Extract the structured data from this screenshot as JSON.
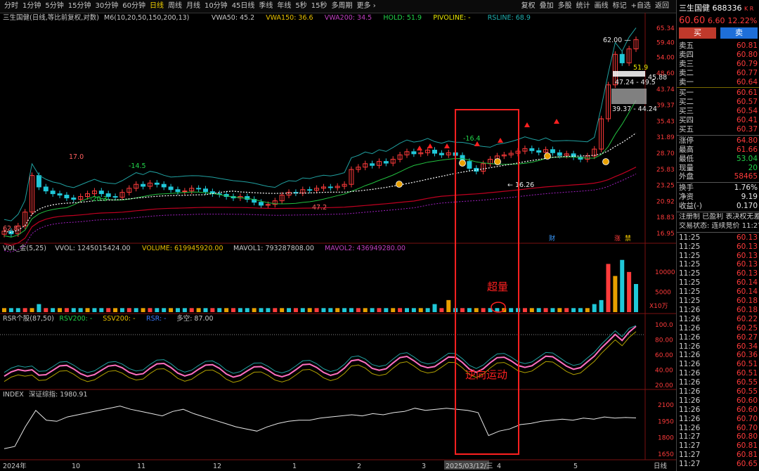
{
  "toolbar": {
    "periods": [
      "分时",
      "1分钟",
      "5分钟",
      "15分钟",
      "30分钟",
      "60分钟",
      "日线",
      "周线",
      "月线",
      "10分钟",
      "45日线",
      "季线",
      "年线",
      "5秒",
      "15秒",
      "多周期",
      "更多 ›"
    ],
    "active_period": "日线",
    "right_items": [
      "复权",
      "叠加",
      "多股",
      "统计",
      "画线",
      "标记",
      "+自选",
      "返回"
    ]
  },
  "main_chart": {
    "title": "三生国健(日线,等比前复权,对数)",
    "indicators": [
      {
        "text": "M6(10,20,50,150,200,13)",
        "color": "#c8c8c8"
      },
      {
        "text": "VWA50: 45.2",
        "color": "#c8c8c8"
      },
      {
        "text": "VWA150: 36.6",
        "color": "#e8c000"
      },
      {
        "text": "VWA200: 34.5",
        "color": "#c040c0"
      },
      {
        "text": "HOLD: 51.9",
        "color": "#22d34a"
      },
      {
        "text": "",
        "color": "#ff3b3b",
        "extra": "34.5"
      },
      {
        "text": "PIVOLINE: -",
        "color": "#e8e800"
      },
      {
        "text": "RSLINE: 68.9",
        "color": "#20b0b0"
      }
    ],
    "price_axis": [
      "65.34",
      "59.40",
      "54.00",
      "48.60",
      "43.74",
      "39.37",
      "35.43",
      "31.89",
      "28.70",
      "25.83",
      "23.25",
      "20.92",
      "18.83",
      "16.95"
    ],
    "annotations": [
      {
        "text": "62.8",
        "color": "#ff6060"
      },
      {
        "text": "17.0",
        "color": "#ff6060"
      },
      {
        "text": "-14.5",
        "color": "#22d34a"
      },
      {
        "text": "-20.3",
        "color": "#22d34a"
      },
      {
        "text": "47.2",
        "color": "#ff6060"
      },
      {
        "text": "-16.4",
        "color": "#22d34a"
      },
      {
        "text": "← 16.26",
        "color": "#e8e8e8"
      },
      {
        "text": "62.00 —",
        "color": "#e8e8e8"
      },
      {
        "text": "51.9",
        "color": "#e8e800"
      },
      {
        "text": "45.88",
        "color": "#e8e8e8"
      },
      {
        "text": "47.24 - 49.5",
        "color": "#e8e8e8"
      },
      {
        "text": "39.37 - 44.24",
        "color": "#e8e8e8"
      }
    ],
    "markers": [
      "财",
      "涨",
      "禁"
    ],
    "red_box_labels": [
      "超量",
      "逆向运动"
    ]
  },
  "volume_panel": {
    "header": [
      {
        "text": "VOL_金(5,25)",
        "color": "#c8c8c8"
      },
      {
        "text": "VVOL: 1245015424.00",
        "color": "#c8c8c8"
      },
      {
        "text": "VOLUME: 619945920.00",
        "color": "#e8c000"
      },
      {
        "text": "MAVOL1: 793287808.00",
        "color": "#c8c8c8"
      },
      {
        "text": "MAVOL2: 436949280.00",
        "color": "#c040c0"
      }
    ],
    "axis": [
      "10000",
      "5000"
    ],
    "unit": "X10万"
  },
  "rsr_panel": {
    "header": [
      {
        "text": "RSR个股(87,50)",
        "color": "#c8c8c8"
      },
      {
        "text": "RSV200: -",
        "color": "#22d34a"
      },
      {
        "text": "SSV200: -",
        "color": "#e8c000"
      },
      {
        "text": "RSR: -",
        "color": "#3a7bff"
      },
      {
        "text": "多空: 87.00",
        "color": "#c8c8c8"
      }
    ],
    "axis": [
      "100.0",
      "80.00",
      "60.00",
      "40.00",
      "20.00"
    ]
  },
  "index_panel": {
    "header": [
      {
        "text": "INDEX",
        "color": "#c8c8c8"
      },
      {
        "text": "深证综指: 1980.91",
        "color": "#c8c8c8"
      }
    ],
    "axis": [
      "2100",
      "1950",
      "1800",
      "1650"
    ]
  },
  "x_axis": {
    "labels": [
      "2024年",
      "10",
      "11",
      "12",
      "1",
      "2",
      "3",
      "2025/03/12/三",
      "4",
      "5"
    ],
    "period": "日线"
  },
  "chart_data": {
    "type": "candlestick",
    "title": "三生国健(日线,等比前复权,对数)",
    "x_range": [
      "2024-09",
      "2025-05"
    ],
    "ylim": [
      16.95,
      65.34
    ],
    "y_scale": "log",
    "labeled_points": [
      {
        "label": "16.26",
        "type": "low"
      },
      {
        "label": "62.8",
        "type": "high"
      },
      {
        "label": "17.0",
        "type": "high"
      },
      {
        "label": "14.5",
        "type": "low"
      },
      {
        "label": "20.3",
        "type": "low"
      },
      {
        "label": "47.2",
        "type": "high"
      },
      {
        "label": "16.4",
        "type": "low"
      },
      {
        "label": "62.00",
        "type": "high"
      }
    ],
    "close_series": [
      17.2,
      16.9,
      17.8,
      19.5,
      24.8,
      23.0,
      22.4,
      22.0,
      21.8,
      21.4,
      21.2,
      21.6,
      22.0,
      22.4,
      22.0,
      21.6,
      21.5,
      22.2,
      22.8,
      23.4,
      23.1,
      23.6,
      23.4,
      23.0,
      22.6,
      22.3,
      22.4,
      22.8,
      22.7,
      22.3,
      22.0,
      21.9,
      21.6,
      21.4,
      21.6,
      21.2,
      20.8,
      20.4,
      20.5,
      21.0,
      21.8,
      22.2,
      22.1,
      22.6,
      22.5,
      22.8,
      23.0,
      22.9,
      23.1,
      23.4,
      25.8,
      26.2,
      26.8,
      26.5,
      27.2,
      26.9,
      27.6,
      28.4,
      29.0,
      28.6,
      28.8,
      29.3,
      28.7,
      28.4,
      28.8,
      28.3,
      27.2,
      26.0,
      25.5,
      26.8,
      27.6,
      28.2,
      28.4,
      28.7,
      29.1,
      29.6,
      29.2,
      28.9,
      29.4,
      28.8,
      28.3,
      28.6,
      28.0,
      27.6,
      28.2,
      29.5,
      36.0,
      45.0,
      55.0,
      52.0,
      57.0,
      60.6
    ],
    "volume_series": [
      1,
      1,
      1,
      1,
      1,
      2,
      1,
      1,
      1,
      1,
      1,
      1,
      1,
      1,
      1,
      1,
      1,
      1,
      1,
      1,
      1,
      1,
      1,
      1,
      1,
      1,
      1,
      1,
      1,
      1,
      1,
      1,
      1,
      1,
      1,
      1,
      1,
      1,
      1,
      1,
      1,
      1,
      1,
      1,
      1,
      1,
      1,
      1,
      1,
      1,
      1,
      1,
      1,
      1,
      1,
      1,
      1,
      1,
      1,
      1,
      1,
      1,
      2,
      1,
      3,
      1,
      1,
      1,
      1,
      1,
      1,
      1,
      1,
      1,
      1,
      1,
      1,
      1,
      1,
      1,
      1,
      1,
      1,
      1,
      1,
      2,
      3,
      12,
      9,
      13,
      10,
      7
    ],
    "index_series": [
      1700,
      1720,
      1900,
      2050,
      1960,
      1950,
      1990,
      2010,
      2030,
      2050,
      2070,
      2090,
      2060,
      2040,
      2020,
      2000,
      2040,
      2060,
      2020,
      1990,
      1960,
      1930,
      1900,
      1880,
      1860,
      1900,
      1930,
      1950,
      1960,
      1960,
      1980,
      1990,
      2000,
      2010,
      2000,
      2020,
      2010,
      2030,
      2040,
      2070,
      2050,
      2060,
      2070,
      2060,
      2050,
      2030,
      1820,
      1860,
      1880,
      1920,
      1930,
      1950,
      1960,
      1970,
      1960,
      1980,
      1970,
      1990,
      1980,
      1985,
      1981
    ]
  },
  "right_panel": {
    "stock_name": "三生国健",
    "stock_code": "688336",
    "badge": "K R",
    "price": "60.60",
    "change": "6.60",
    "change_pct": "12.22%",
    "buy_label": "买",
    "sell_label": "卖",
    "ask": [
      {
        "label": "卖五",
        "price": "60.81"
      },
      {
        "label": "卖四",
        "price": "60.80"
      },
      {
        "label": "卖三",
        "price": "60.79"
      },
      {
        "label": "卖二",
        "price": "60.77"
      },
      {
        "label": "卖一",
        "price": "60.64"
      }
    ],
    "bid": [
      {
        "label": "买一",
        "price": "60.61"
      },
      {
        "label": "买二",
        "price": "60.57"
      },
      {
        "label": "买三",
        "price": "60.54"
      },
      {
        "label": "买四",
        "price": "60.41"
      },
      {
        "label": "买五",
        "price": "60.37"
      }
    ],
    "stats": [
      {
        "label": "涨停",
        "value": "64.80",
        "cls": "red"
      },
      {
        "label": "最高",
        "value": "61.66",
        "cls": "red"
      },
      {
        "label": "最低",
        "value": "53.04",
        "cls": "green"
      },
      {
        "label": "现量",
        "value": "20",
        "cls": "green"
      },
      {
        "label": "外盘",
        "value": "58465",
        "cls": "red"
      }
    ],
    "stats2": [
      {
        "label": "换手",
        "value": "1.76%",
        "cls": "white"
      },
      {
        "label": "净资",
        "value": "9.19",
        "cls": "white"
      },
      {
        "label": "收益(-)",
        "value": "0.170",
        "cls": "white"
      }
    ],
    "info1": "注册制 已盈利 表决权无差",
    "info2": "交易状态: 连续竞价 11:27",
    "ticks": [
      {
        "t": "11:25",
        "p": "60.13"
      },
      {
        "t": "11:25",
        "p": "60.13"
      },
      {
        "t": "11:25",
        "p": "60.13"
      },
      {
        "t": "11:25",
        "p": "60.13"
      },
      {
        "t": "11:25",
        "p": "60.13"
      },
      {
        "t": "11:25",
        "p": "60.14"
      },
      {
        "t": "11:25",
        "p": "60.14"
      },
      {
        "t": "11:25",
        "p": "60.18"
      },
      {
        "t": "11:26",
        "p": "60.18"
      },
      {
        "t": "11:26",
        "p": "60.22"
      },
      {
        "t": "11:26",
        "p": "60.25"
      },
      {
        "t": "11:26",
        "p": "60.27"
      },
      {
        "t": "11:26",
        "p": "60.34"
      },
      {
        "t": "11:26",
        "p": "60.36"
      },
      {
        "t": "11:26",
        "p": "60.51"
      },
      {
        "t": "11:26",
        "p": "60.51"
      },
      {
        "t": "11:26",
        "p": "60.55"
      },
      {
        "t": "11:26",
        "p": "60.55"
      },
      {
        "t": "11:26",
        "p": "60.60"
      },
      {
        "t": "11:26",
        "p": "60.60"
      },
      {
        "t": "11:26",
        "p": "60.70"
      },
      {
        "t": "11:26",
        "p": "60.70"
      },
      {
        "t": "11:27",
        "p": "60.80"
      },
      {
        "t": "11:27",
        "p": "60.81"
      },
      {
        "t": "11:27",
        "p": "60.81"
      },
      {
        "t": "11:27",
        "p": "60.65"
      }
    ]
  }
}
